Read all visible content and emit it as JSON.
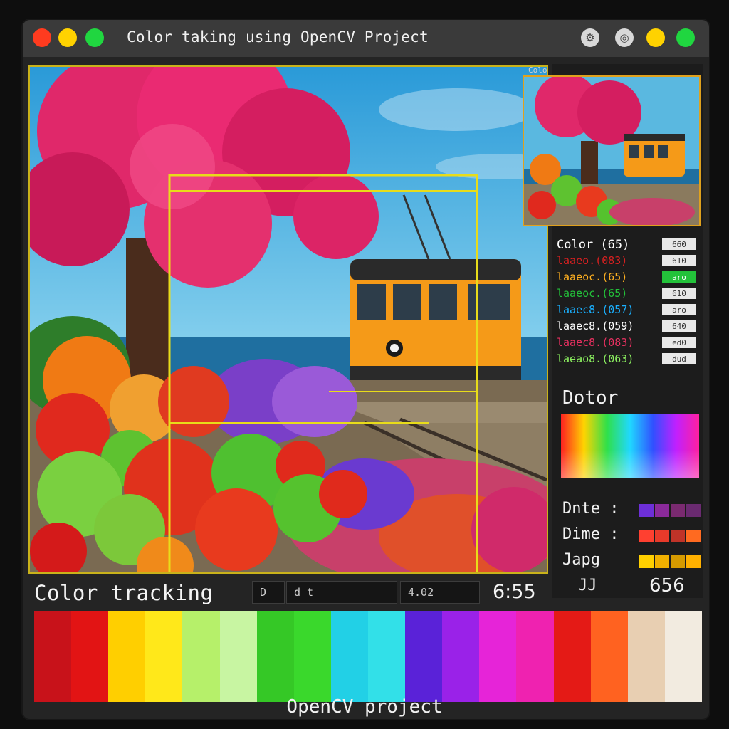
{
  "window": {
    "title": "Color taking using OpenCV Project",
    "traffic_lights": [
      "#ff3b1f",
      "#ffd200",
      "#20d640"
    ],
    "right_icons": [
      "settings-icon",
      "capture-icon"
    ],
    "right_dots": [
      "#ffd200",
      "#20d640"
    ]
  },
  "main_view": {
    "scene": "tree-train-fruit-photo",
    "tracking_box_color": "#e8dc1a"
  },
  "side_panel": {
    "thumbnail_caption": "Colo",
    "color_list": [
      {
        "label": "Color (65)",
        "tag": "660",
        "color": "#ffffff"
      },
      {
        "label": "laaeo.(083)",
        "tag": "610",
        "color": "#d72020"
      },
      {
        "label": "laaeoc.(65)",
        "tag": "aro",
        "color": "#ffb020"
      },
      {
        "label": "laaeoc.(65)",
        "tag": "610",
        "color": "#23c23a"
      },
      {
        "label": "laaec8.(057)",
        "tag": "aro",
        "color": "#1ab0ff"
      },
      {
        "label": "laaec8.(059)",
        "tag": "640",
        "color": "#ffffff"
      },
      {
        "label": "laaec8.(083)",
        "tag": "ed0",
        "color": "#e83060"
      },
      {
        "label": "laeao8.(063)",
        "tag": "dud",
        "color": "#8cf060"
      }
    ],
    "palette_label": "Dotor",
    "meta": [
      {
        "label": "Dnte :",
        "swatches": [
          "#6d2fd8",
          "#8a2a9a",
          "#7a2a70",
          "#6a2a70"
        ]
      },
      {
        "label": "Dime :",
        "swatches": [
          "#ff4030",
          "#e83a2a",
          "#c03328",
          "#ff6a20"
        ]
      },
      {
        "label": "Japg",
        "swatches": [
          "#ffd000",
          "#f0b000",
          "#d59a00",
          "#ffb000"
        ]
      }
    ],
    "foot_left": "JJ",
    "foot_right": "656"
  },
  "status_bar": {
    "label": "Color tracking",
    "field1": "D",
    "field2": "d t",
    "field3": "4.02",
    "time": "6:55"
  },
  "swatch_strip": [
    "#c8121a",
    "#e21414",
    "#ffcf00",
    "#ffe81a",
    "#b6f06a",
    "#c8f5a2",
    "#35c826",
    "#3ad82c",
    "#22d0e6",
    "#32e0e8",
    "#5a22d8",
    "#9a22e8",
    "#e624d8",
    "#ef22b0",
    "#e41a16",
    "#ff6220",
    "#e8cfb2",
    "#f2ebe0"
  ],
  "footer": "OpenCV project"
}
